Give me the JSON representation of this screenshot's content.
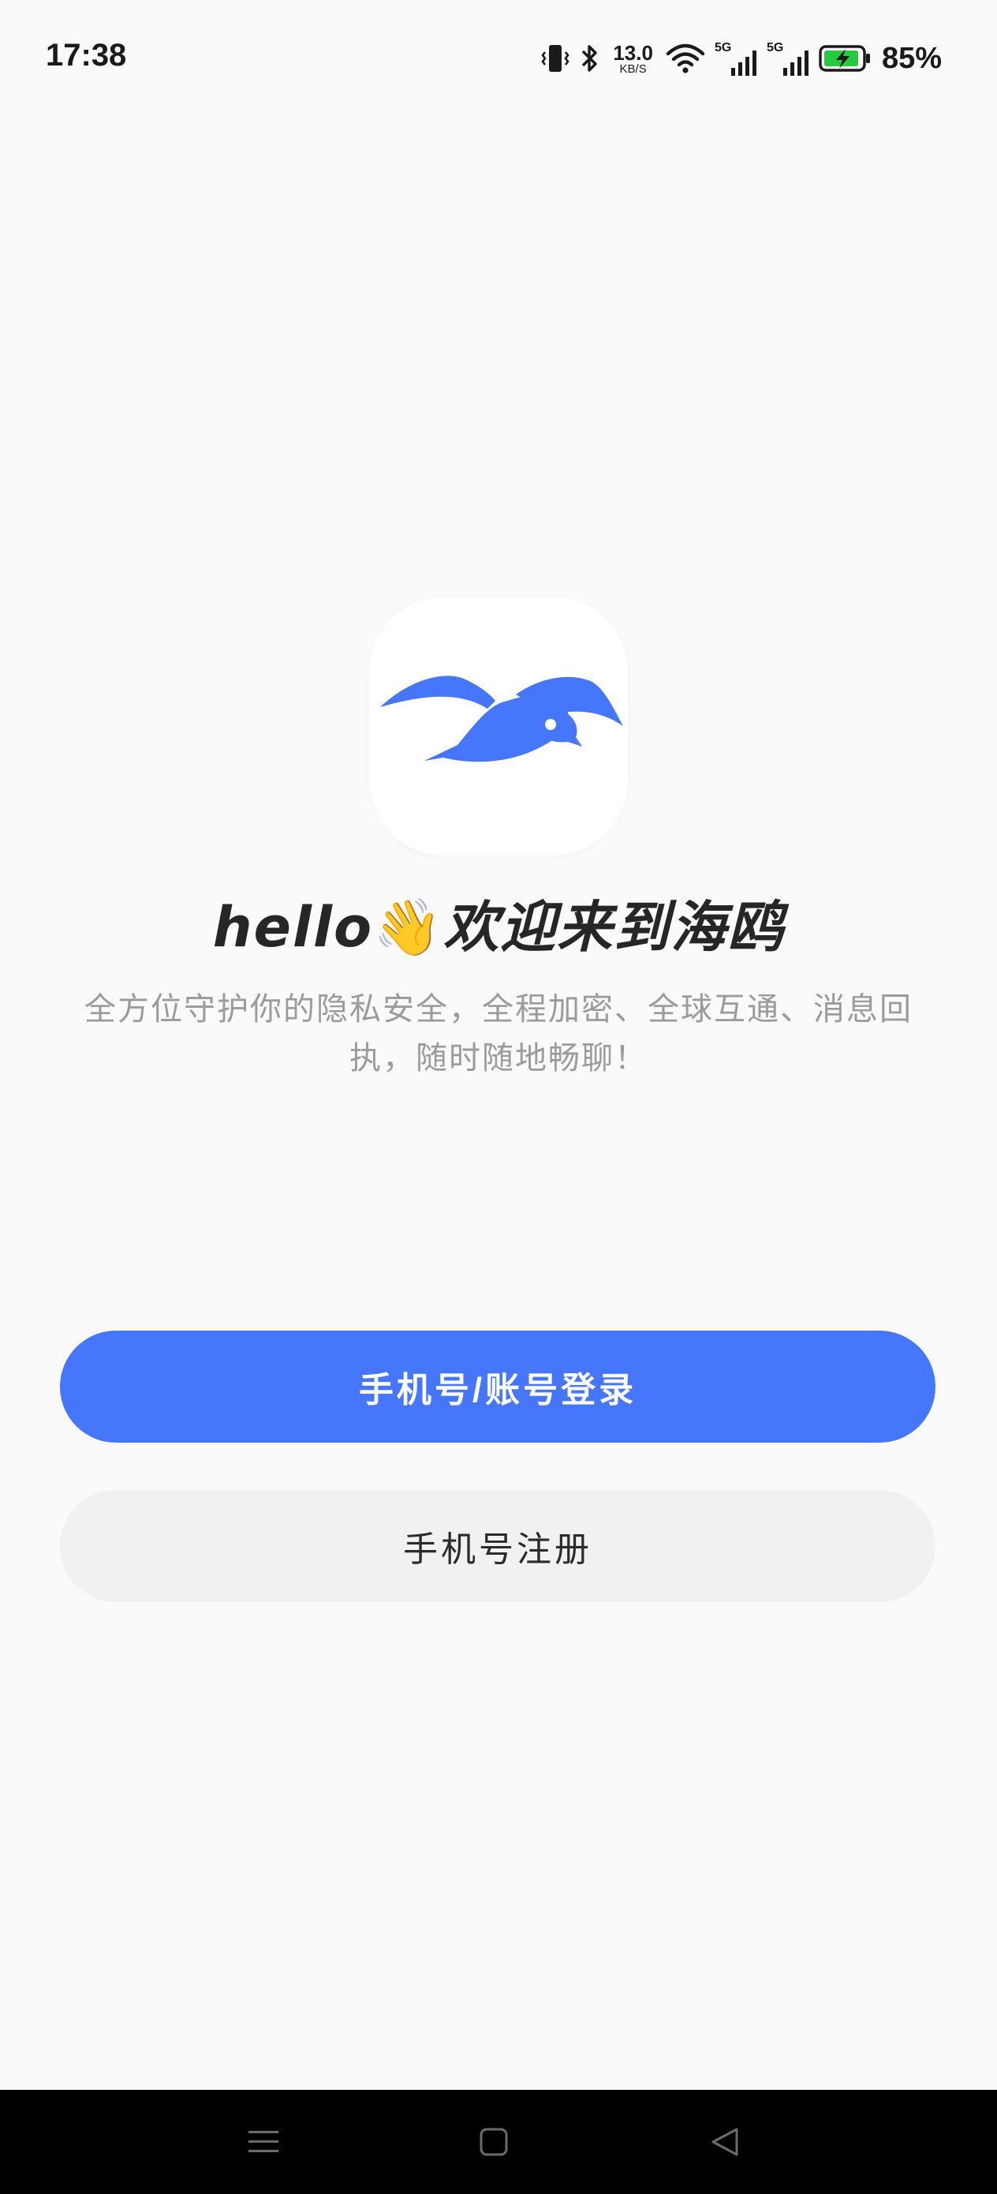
{
  "status_bar": {
    "time": "17:38",
    "net_speed_value": "13.0",
    "net_speed_unit": "KB/S",
    "signal_1_label": "5G",
    "signal_2_label": "5G",
    "battery_percent": "85%",
    "icons": [
      "vibrate-icon",
      "bluetooth-icon",
      "wifi-icon",
      "signal-icon",
      "signal-icon",
      "battery-charging-icon"
    ]
  },
  "brand": {
    "logo": "seagull-logo",
    "accent_color": "#4576fc"
  },
  "welcome": {
    "greeting": "hello",
    "wave_emoji": "👋",
    "title": "欢迎来到海鸥",
    "description": "全方位守护你的隐私安全，全程加密、全球互通、消息回执，随时随地畅聊！"
  },
  "actions": {
    "login_label": "手机号/账号登录",
    "register_label": "手机号注册"
  },
  "nav_bar": {
    "icons": [
      "menu-icon",
      "home-icon",
      "back-icon"
    ]
  }
}
